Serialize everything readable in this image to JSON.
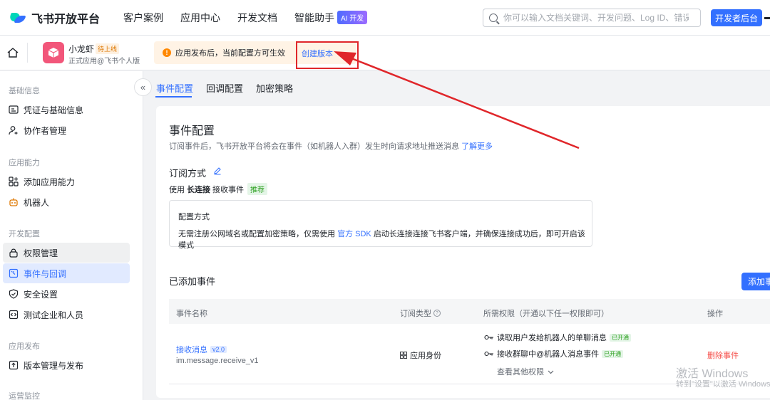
{
  "topnav": {
    "brand": "飞书开放平台",
    "links": [
      "客户案例",
      "应用中心",
      "开发文档",
      "智能助手"
    ],
    "ai_badge": "AI 开发",
    "search_placeholder": "你可以输入文档关键词、开发问题、Log ID、错误码",
    "dev_button": "开发者后台"
  },
  "app": {
    "name": "小龙虾",
    "status": "待上线",
    "subtitle": "正式应用@飞书个人版",
    "notice": "应用发布后，当前配置方可生效",
    "create_version": "创建版本"
  },
  "sidebar": {
    "sections": [
      "基础信息",
      "应用能力",
      "开发配置",
      "应用发布",
      "运营监控"
    ],
    "items": [
      "凭证与基础信息",
      "协作者管理",
      "添加应用能力",
      "机器人",
      "权限管理",
      "事件与回调",
      "安全设置",
      "测试企业和人员",
      "版本管理与发布"
    ]
  },
  "tabs": [
    "事件配置",
    "回调配置",
    "加密策略"
  ],
  "event_config": {
    "title": "事件配置",
    "desc": "订阅事件后，飞书开放平台将会在事件（如机器人入群）发生时向请求地址推送消息",
    "learn_more": "了解更多",
    "subscribe_title": "订阅方式",
    "use_prefix": "使用",
    "use_bold": "长连接",
    "use_suffix": "接收事件",
    "recommend": "推荐",
    "config_title": "配置方式",
    "config_desc_1": "无需注册公网域名或配置加密策略，仅需使用",
    "config_link": "官方 SDK",
    "config_desc_2": "启动长连接连接飞书客户端，并确保连接成功后，即可开启该模式"
  },
  "added_events": {
    "title": "已添加事件",
    "add_button": "添加事件",
    "headers": [
      "事件名称",
      "订阅类型",
      "所需权限（开通以下任一权限即可）",
      "操作"
    ],
    "row": {
      "name": "接收消息",
      "version": "v2.0",
      "code": "im.message.receive_v1",
      "type": "应用身份",
      "perms": [
        "读取用户发给机器人的单聊消息",
        "接收群聊中@机器人消息事件"
      ],
      "perm_status": "已开通",
      "more": "查看其他权限",
      "action": "删除事件"
    }
  },
  "watermark": {
    "line1": "激活 Windows",
    "line2": "转到\"设置\"以激活 Windows。"
  },
  "colors": {
    "accent": "#3370ff",
    "annotation": "#e0262a",
    "danger": "#f54a45",
    "success": "#2ea121"
  }
}
